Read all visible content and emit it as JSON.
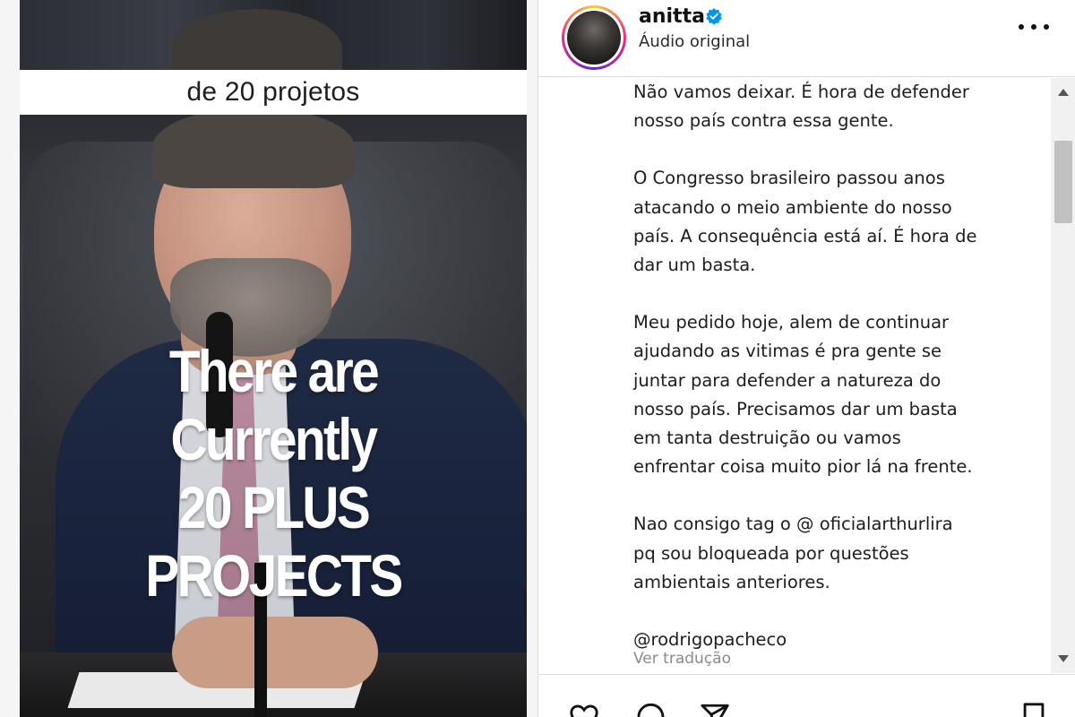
{
  "video": {
    "caption_bar": "de 20 projetos",
    "overlay_lines": [
      "There are",
      "Currently",
      "20 PLUS",
      "PROJECTS"
    ]
  },
  "post": {
    "username": "anitta",
    "verified": true,
    "audio_label": "Áudio original",
    "caption": {
      "p1": [
        "Não vamos deixar. É hora de defender",
        "nosso país contra essa gente."
      ],
      "p2": [
        "O Congresso brasileiro passou anos",
        "atacando o meio ambiente do nosso",
        "país. A consequência está aí. É hora de",
        "dar um basta."
      ],
      "p3": [
        "Meu pedido hoje, alem de continuar",
        "ajudando as vitimas é pra gente se",
        "juntar para defender a natureza do",
        "nosso país. Precisamos dar um basta",
        "em tanta destruição ou vamos",
        "enfrentar coisa muito pior lá na frente."
      ],
      "p4": [
        "Nao consigo tag o @ oficialarthurlira",
        "pq sou bloqueada por questões",
        "ambientais anteriores."
      ],
      "mention": "@rodrigopacheco"
    },
    "see_translation": "Ver tradução"
  },
  "colors": {
    "verified_blue": "#0095f6",
    "border": "#dbdbdb",
    "muted_text": "#8a8a8a"
  },
  "icons": [
    "more-options-icon",
    "verified-badge-icon",
    "heart-icon",
    "comment-icon",
    "share-icon",
    "bookmark-icon"
  ]
}
